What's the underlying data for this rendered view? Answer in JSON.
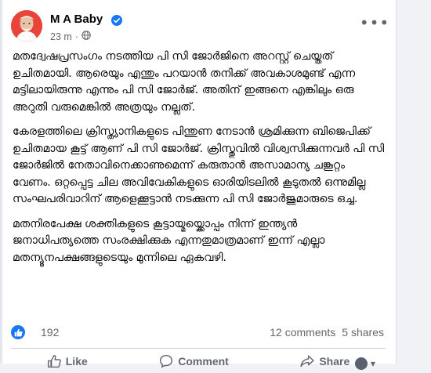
{
  "post": {
    "author": "M A Baby",
    "time": "23 m",
    "paragraphs": [
      "മതദ്വേഷപ്രസംഗം നടത്തിയ പി സി ജോർജിനെ അറസ്റ്റ് ചെയ്തത് ഉചിതമായി. ആരെയും എന്തും പറയാൻ തനിക്ക് അവകാശമുണ്ട് എന്ന മട്ടിലായിരുന്നു എന്നും പി സി ജോർജ്. അതിന് ഇങ്ങനെ എങ്കിലും ഒരു അറുതി വരുമെങ്കിൽ അത്രയും നല്ലത്.",
      "കേരളത്തിലെ ക്രിസ്ത്യാനികളുടെ പിന്തുണ നേടാൻ ശ്രമിക്കുന്ന ബിജെപിക്ക് ഉചിതമായ കൂട്ട് ആണ് പി സി ജോർജ്. ക്രിസ്തുവിൽ വിശ്വസിക്കുന്നവർ പി സി ജോർജിൽ നേതാവിനെക്കാണുമെന്ന് കരുതാൻ അസാമാന്യ ചങ്കൂറ്റം വേണം. ഒറ്റപ്പെട്ട ചില അവിവേകികളുടെ ഓരിയിടലിൽ കൂടുതൽ ഒന്നുമില്ല സംഘപരിവാറിന് ആളെക്കൂട്ടാൻ നടക്കുന്ന പി സി ജോർജുമാരുടെ ഒച്ച.",
      "മതനിരപേക്ഷ ശക്തികളുടെ കൂട്ടായ്മയ്ക്കൊപ്പം നിന്ന് ഇന്ത്യൻ ജനാധിപത്യത്തെ സംരക്ഷിക്കുക എന്നതുമാത്രമാണ് ഇന്ന് എല്ലാ മതന്യൂനപക്ഷങ്ങളുടെയും മുന്നിലെ ഏകവഴി."
    ]
  },
  "reactions": {
    "count": "192",
    "comments": "12 comments",
    "shares": "5 shares"
  },
  "actions": {
    "like": "Like",
    "comment": "Comment",
    "share": "Share"
  },
  "icons": [
    "avatar",
    "verified-badge-icon",
    "globe-icon",
    "more-options-icon",
    "like-reaction-icon",
    "like-icon",
    "comment-icon",
    "share-icon"
  ],
  "colors": {
    "accent": "#1877f2",
    "muted": "#65676b",
    "avatar_bg": "#e9443a"
  }
}
